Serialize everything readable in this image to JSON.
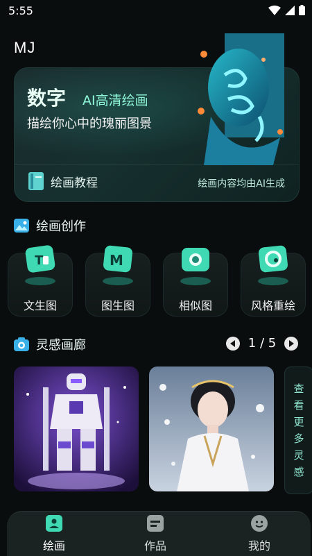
{
  "status": {
    "time": "5:55"
  },
  "app": {
    "title": "MJ"
  },
  "banner": {
    "title": "数字",
    "accent": "AI高清绘画",
    "description": "描绘你心中的瑰丽图景",
    "tutorial_label": "绘画教程",
    "note": "绘画内容均由AI生成"
  },
  "creation": {
    "heading": "绘画创作",
    "tools": [
      {
        "label": "文生图",
        "icon": "text-to-image-icon"
      },
      {
        "label": "图生图",
        "icon": "image-to-image-icon"
      },
      {
        "label": "相似图",
        "icon": "similar-image-icon"
      },
      {
        "label": "风格重绘",
        "icon": "style-repaint-icon"
      }
    ]
  },
  "gallery": {
    "heading": "灵感画廊",
    "page": "1 / 5",
    "see_more": [
      "查",
      "看",
      "更",
      "多",
      "灵",
      "感"
    ]
  },
  "tabs": [
    {
      "label": "绘画",
      "active": true
    },
    {
      "label": "作品",
      "active": false
    },
    {
      "label": "我的",
      "active": false
    }
  ],
  "colors": {
    "accent": "#3fd9b4",
    "active_tab": "#ffffff",
    "inactive_tab": "#bfc6c5",
    "background": "#0a0d0d"
  }
}
